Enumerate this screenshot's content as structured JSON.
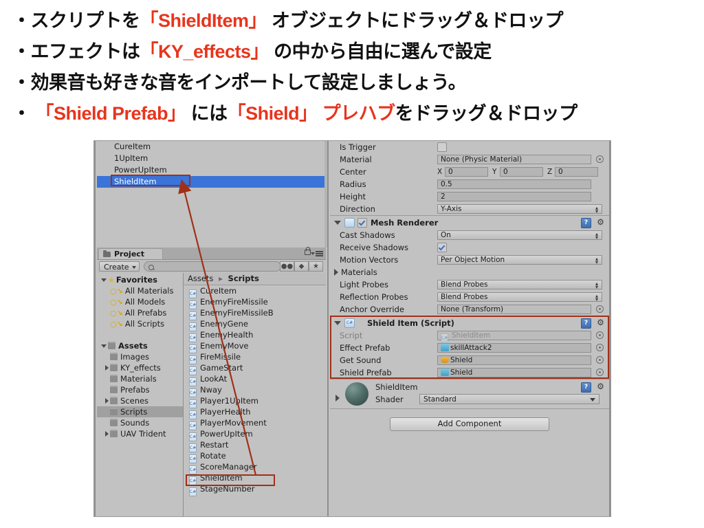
{
  "slide": {
    "bullets": [
      [
        {
          "t": "・スクリプトを",
          "hl": false
        },
        {
          "t": "「ShieldItem」",
          "hl": true
        },
        {
          "t": " オブジェクトにドラッグ＆ドロップ",
          "hl": false
        }
      ],
      [
        {
          "t": "・エフェクトは",
          "hl": false
        },
        {
          "t": "「KY_effects」",
          "hl": true
        },
        {
          "t": " の中から自由に選んで設定",
          "hl": false
        }
      ],
      [
        {
          "t": "・効果音も好きな音をインポートして設定しましょう。",
          "hl": false
        }
      ],
      [
        {
          "t": "・ ",
          "hl": false
        },
        {
          "t": "「Shield Prefab」",
          "hl": true
        },
        {
          "t": " には",
          "hl": false
        },
        {
          "t": "「Shield」 プレハブ",
          "hl": true
        },
        {
          "t": "をドラッグ＆ドロップ",
          "hl": false
        }
      ]
    ]
  },
  "hierarchy": {
    "items": [
      {
        "label": "CureItem",
        "selected": false
      },
      {
        "label": "1UpItem",
        "selected": false
      },
      {
        "label": "PowerUpItem",
        "selected": false
      },
      {
        "label": "ShieldItem",
        "selected": true
      }
    ]
  },
  "project": {
    "tab_label": "Project",
    "create_label": "Create",
    "search_placeholder": "",
    "search_value": "",
    "toolbar_icons": [
      "people-icon",
      "tag-icon",
      "star-icon"
    ],
    "lock_icon": "lock-icon",
    "menu_icon": "hamburger-menu-icon",
    "tree": [
      {
        "label": "Favorites",
        "indent": 0,
        "arrow": "down",
        "icon": "star-icon",
        "bold": true,
        "selected": false
      },
      {
        "label": "All Materials",
        "indent": 1,
        "arrow": "none",
        "icon": "magnifier-icon",
        "bold": false,
        "selected": false
      },
      {
        "label": "All Models",
        "indent": 1,
        "arrow": "none",
        "icon": "magnifier-icon",
        "bold": false,
        "selected": false
      },
      {
        "label": "All Prefabs",
        "indent": 1,
        "arrow": "none",
        "icon": "magnifier-icon",
        "bold": false,
        "selected": false
      },
      {
        "label": "All Scripts",
        "indent": 1,
        "arrow": "none",
        "icon": "magnifier-icon",
        "bold": false,
        "selected": false
      },
      {
        "label": "",
        "indent": 0,
        "arrow": "none",
        "icon": "none",
        "bold": false,
        "selected": false
      },
      {
        "label": "Assets",
        "indent": 0,
        "arrow": "down",
        "icon": "folder-icon",
        "bold": true,
        "selected": false
      },
      {
        "label": "Images",
        "indent": 1,
        "arrow": "none",
        "icon": "folder-icon",
        "bold": false,
        "selected": false
      },
      {
        "label": "KY_effects",
        "indent": 1,
        "arrow": "right",
        "icon": "folder-icon",
        "bold": false,
        "selected": false
      },
      {
        "label": "Materials",
        "indent": 1,
        "arrow": "none",
        "icon": "folder-icon",
        "bold": false,
        "selected": false
      },
      {
        "label": "Prefabs",
        "indent": 1,
        "arrow": "none",
        "icon": "folder-icon",
        "bold": false,
        "selected": false
      },
      {
        "label": "Scenes",
        "indent": 1,
        "arrow": "right",
        "icon": "folder-icon",
        "bold": false,
        "selected": false
      },
      {
        "label": "Scripts",
        "indent": 1,
        "arrow": "none",
        "icon": "folder-icon",
        "bold": false,
        "selected": true
      },
      {
        "label": "Sounds",
        "indent": 1,
        "arrow": "none",
        "icon": "folder-icon",
        "bold": false,
        "selected": false
      },
      {
        "label": "UAV Trident",
        "indent": 1,
        "arrow": "right",
        "icon": "folder-icon",
        "bold": false,
        "selected": false
      }
    ],
    "breadcrumb": {
      "root": "Assets",
      "current": "Scripts"
    },
    "assets": [
      {
        "label": "CureItem",
        "highlighted": false
      },
      {
        "label": "EnemyFireMissile",
        "highlighted": false
      },
      {
        "label": "EnemyFireMissileB",
        "highlighted": false
      },
      {
        "label": "EnemyGene",
        "highlighted": false
      },
      {
        "label": "EnemyHealth",
        "highlighted": false
      },
      {
        "label": "EnemyMove",
        "highlighted": false
      },
      {
        "label": "FireMissile",
        "highlighted": false
      },
      {
        "label": "GameStart",
        "highlighted": false
      },
      {
        "label": "LookAt",
        "highlighted": false
      },
      {
        "label": "Nway",
        "highlighted": false
      },
      {
        "label": "Player1UpItem",
        "highlighted": false
      },
      {
        "label": "PlayerHealth",
        "highlighted": false
      },
      {
        "label": "PlayerMovement",
        "highlighted": false
      },
      {
        "label": "PowerUpItem",
        "highlighted": false
      },
      {
        "label": "Restart",
        "highlighted": false
      },
      {
        "label": "Rotate",
        "highlighted": false
      },
      {
        "label": "ScoreManager",
        "highlighted": false
      },
      {
        "label": "ShieldItem",
        "highlighted": true
      },
      {
        "label": "StageNumber",
        "highlighted": false
      }
    ]
  },
  "inspector": {
    "collider": {
      "rows": [
        {
          "label": "Is Trigger",
          "type": "checkbox",
          "checked": false
        },
        {
          "label": "Material",
          "type": "object",
          "value": "None (Physic Material)"
        },
        {
          "label": "Center",
          "type": "vector3",
          "x": "0",
          "y": "0",
          "z": "0"
        },
        {
          "label": "Radius",
          "type": "text",
          "value": "0.5"
        },
        {
          "label": "Height",
          "type": "text",
          "value": "2"
        },
        {
          "label": "Direction",
          "type": "popup",
          "value": "Y-Axis"
        }
      ]
    },
    "mesh_renderer": {
      "title": "Mesh Renderer",
      "enabled": true,
      "icon": "mesh-renderer-icon",
      "help_icon": "help-icon",
      "gear_icon": "gear-icon",
      "rows": [
        {
          "label": "Cast Shadows",
          "type": "popup",
          "value": "On"
        },
        {
          "label": "Receive Shadows",
          "type": "checkbox",
          "checked": true
        },
        {
          "label": "Motion Vectors",
          "type": "popup",
          "value": "Per Object Motion"
        },
        {
          "label": "Materials",
          "type": "foldout",
          "value": ""
        },
        {
          "label": "Light Probes",
          "type": "popup",
          "value": "Blend Probes"
        },
        {
          "label": "Reflection Probes",
          "type": "popup",
          "value": "Blend Probes"
        },
        {
          "label": "Anchor Override",
          "type": "object",
          "value": "None (Transform)"
        }
      ]
    },
    "shield_item_script": {
      "title": "Shield Item (Script)",
      "icon": "cs-script-icon",
      "help_icon": "help-icon",
      "gear_icon": "gear-icon",
      "rows": [
        {
          "label": "Script",
          "value": "ShieldItem",
          "icon": "cs-script-icon",
          "dim": true
        },
        {
          "label": "Effect Prefab",
          "value": "skillAttack2",
          "icon": "prefab-cube-icon",
          "dim": false
        },
        {
          "label": "Get Sound",
          "value": "Shield",
          "icon": "audio-clip-icon",
          "dim": false
        },
        {
          "label": "Shield Prefab",
          "value": "Shield",
          "icon": "prefab-cube-icon",
          "dim": false
        }
      ]
    },
    "material": {
      "name": "ShieldItem",
      "shader_label": "Shader",
      "shader_value": "Standard",
      "preview_icon": "material-sphere-preview",
      "help_icon": "help-icon",
      "gear_icon": "gear-icon"
    },
    "add_component_label": "Add Component"
  },
  "annotation": {
    "accent_color": "#a03018",
    "highlight_color": "#e8341c",
    "selection_color": "#3a74d8"
  }
}
